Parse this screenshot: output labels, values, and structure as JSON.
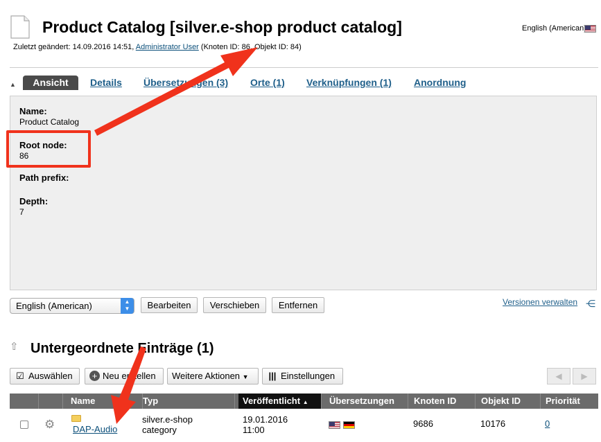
{
  "header": {
    "title": "Product Catalog [silver.e-shop product catalog]",
    "language": "English (American)",
    "meta_prefix": "Zuletzt geändert: 14.09.2016 14:51,",
    "meta_user": "Administrator User",
    "meta_suffix": "(Knoten ID: 86, Objekt ID: 84)"
  },
  "tabs": [
    {
      "label": "Ansicht",
      "active": true
    },
    {
      "label": "Details"
    },
    {
      "label": "Übersetzungen (3)"
    },
    {
      "label": "Orte (1)"
    },
    {
      "label": "Verknüpfungen (1)"
    },
    {
      "label": "Anordnung"
    }
  ],
  "fields": [
    {
      "label": "Name:",
      "value": "Product Catalog"
    },
    {
      "label": "Root node:",
      "value": "86"
    },
    {
      "label": "Path prefix:",
      "value": ""
    },
    {
      "label": "Depth:",
      "value": "7"
    }
  ],
  "actions": {
    "language_select": "English (American)",
    "edit": "Bearbeiten",
    "move": "Verschieben",
    "remove": "Entfernen",
    "versions": "Versionen verwalten"
  },
  "children": {
    "title": "Untergeordnete Einträge (1)",
    "toolbar": {
      "select": "Auswählen",
      "create": "Neu erstellen",
      "more": "Weitere Aktionen",
      "settings": "Einstellungen"
    },
    "columns": [
      "Name",
      "Typ",
      "Veröffentlicht",
      "Übersetzungen",
      "Knoten ID",
      "Objekt ID",
      "Priorität"
    ],
    "rows": [
      {
        "name": "DAP-Audio",
        "type_line1": "silver.e-shop",
        "type_line2": "category",
        "published_date": "19.01.2016",
        "published_time": "11:00",
        "node_id": "9686",
        "object_id": "10176",
        "priority": "0"
      }
    ]
  },
  "colors": {
    "accent": "#1f5f8a",
    "callout": "#f0321c",
    "header_bg": "#6b6b6b"
  }
}
